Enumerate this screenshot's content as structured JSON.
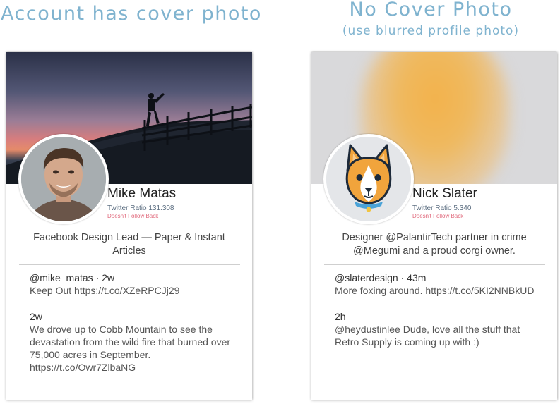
{
  "headings": {
    "left": "Account has cover photo",
    "right_title": "No Cover Photo",
    "right_subtitle": "(use blurred profile photo)"
  },
  "cards": [
    {
      "name": "Mike Matas",
      "ratio": "Twitter Ratio 131.308",
      "follow_status": "Doesn't Follow Back",
      "bio": "Facebook Design Lead — Paper & Instant Articles",
      "tweets": [
        {
          "meta": "@mike_matas · 2w",
          "text": "Keep Out https://t.co/XZeRPCJj29"
        },
        {
          "meta": "2w",
          "text": "We drove up to Cobb Mountain to see the devastation from the wild fire that burned over 75,000 acres in September. https://t.co/Owr7ZlbaNG"
        }
      ]
    },
    {
      "name": "Nick Slater",
      "ratio": "Twitter Ratio 5.340",
      "follow_status": "Doesn't Follow Back",
      "bio": "Designer @PalantirTech partner in crime @Megumi and a proud corgi owner.",
      "tweets": [
        {
          "meta": "@slaterdesign · 43m",
          "text": "More foxing around. https://t.co/5KI2NNBkUD"
        },
        {
          "meta": "2h",
          "text": "@heydustinlee Dude, love all the stuff that Retro Supply is coming up with :)"
        }
      ]
    }
  ],
  "colors": {
    "heading": "#7fb3cf",
    "ratio": "#5b6d80",
    "follow_status": "#e0677a",
    "corgi_orange": "#f1a43c"
  }
}
